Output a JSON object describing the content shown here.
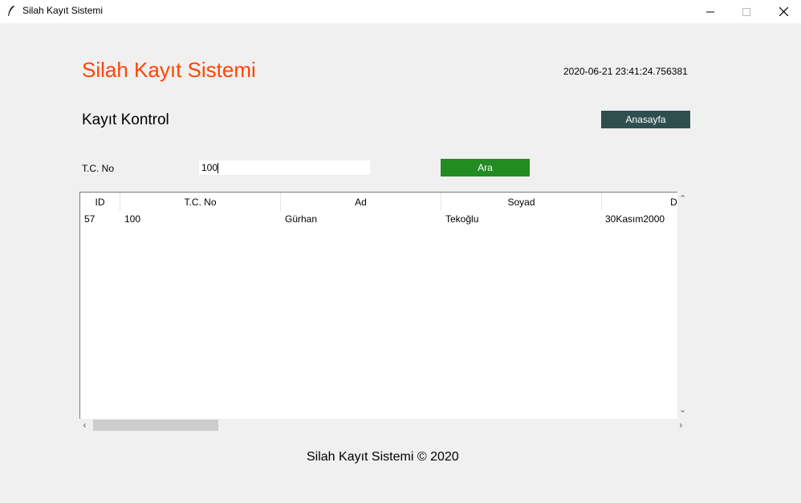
{
  "window": {
    "title": "Silah Kayıt Sistemi",
    "icon": "feather-icon",
    "controls": [
      "minimize-icon",
      "maximize-icon",
      "close-icon"
    ]
  },
  "header": {
    "app_title": "Silah Kayıt Sistemi",
    "datetime": "2020-06-21 23:41:24.756381"
  },
  "section": {
    "title": "Kayıt Kontrol",
    "home_button": "Anasayfa"
  },
  "search": {
    "label": "T.C. No",
    "value": "100",
    "button": "Ara"
  },
  "table": {
    "columns": [
      "ID",
      "T.C. No",
      "Ad",
      "Soyad",
      "Doğu"
    ],
    "rows": [
      [
        "57",
        "100",
        "Gürhan",
        "Tekoğlu",
        "30Kasım2000"
      ]
    ]
  },
  "footer": {
    "text": "Silah Kayıt Sistemi © 2020"
  },
  "colors": {
    "title": "#ff4500",
    "home_button": "#2f4f4f",
    "search_button": "#228b22",
    "background": "#f0f0f0"
  }
}
